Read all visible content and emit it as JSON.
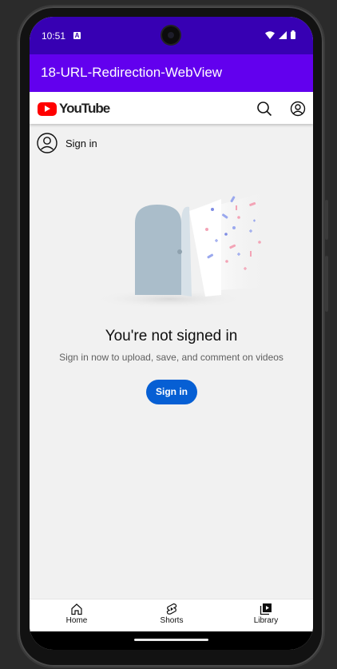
{
  "status_bar": {
    "time": "10:51",
    "notification_letter": "A",
    "icons": [
      "wifi-icon",
      "signal-icon",
      "battery-icon"
    ]
  },
  "app_bar": {
    "title": "18-URL-Redirection-WebView",
    "color": "#6200ee"
  },
  "youtube_header": {
    "logo_text": "YouTube",
    "icons": [
      "search-icon",
      "account-icon"
    ]
  },
  "signin_row": {
    "label": "Sign in"
  },
  "empty_state": {
    "headline": "You're not signed in",
    "subtext": "Sign in now to upload, save, and comment on videos",
    "button_label": "Sign in",
    "button_color": "#065fd4"
  },
  "bottom_nav": {
    "items": [
      {
        "label": "Home",
        "icon": "home-icon"
      },
      {
        "label": "Shorts",
        "icon": "shorts-icon"
      },
      {
        "label": "Library",
        "icon": "library-icon"
      }
    ]
  }
}
